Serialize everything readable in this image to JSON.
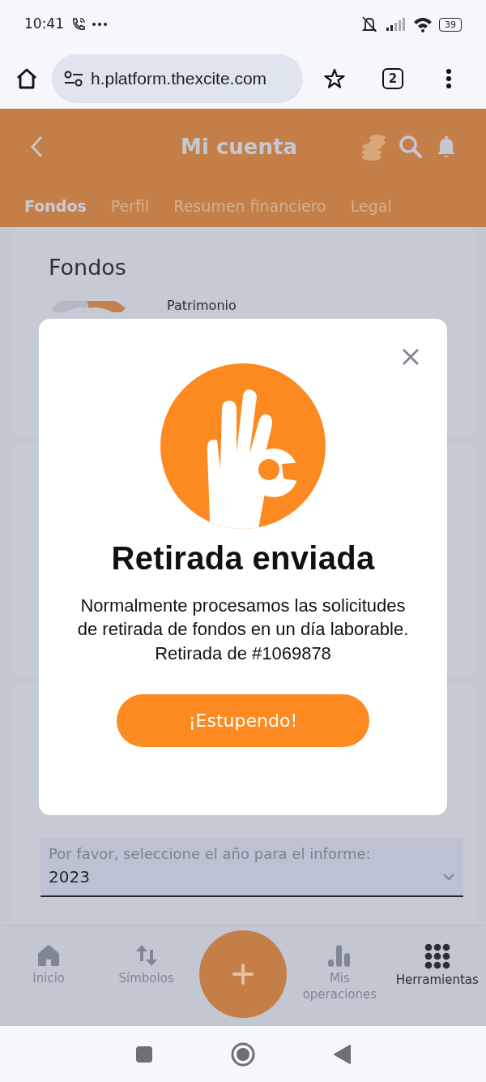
{
  "status_bar": {
    "time": "10:41",
    "battery": "39"
  },
  "browser": {
    "url": "h.platform.thexcite.com",
    "tab_count": "2"
  },
  "header": {
    "title": "Mi cuenta"
  },
  "tabs": [
    {
      "label": "Fondos",
      "selected": true
    },
    {
      "label": "Perfil",
      "selected": false
    },
    {
      "label": "Resumen financiero",
      "selected": false
    },
    {
      "label": "Legal",
      "selected": false
    }
  ],
  "funds_card": {
    "title": "Fondos",
    "label": "Patrimonio"
  },
  "report": {
    "field_label": "Por favor, seleccione el año para el informe:",
    "value": "2023"
  },
  "modal": {
    "title": "Retirada enviada",
    "message": "Normalmente procesamos las solicitudes de retirada de fondos en un día laborable. Retirada de #1069878",
    "button": "¡Estupendo!"
  },
  "bottom_nav": [
    {
      "kind": "home",
      "label": "Inicio",
      "selected": false
    },
    {
      "kind": "arrows",
      "label": "Símbolos",
      "selected": false
    },
    {
      "kind": "fab"
    },
    {
      "kind": "chart",
      "label": "Mis operaciones",
      "selected": false
    },
    {
      "kind": "grid",
      "label": "Herramientas",
      "selected": true
    }
  ]
}
